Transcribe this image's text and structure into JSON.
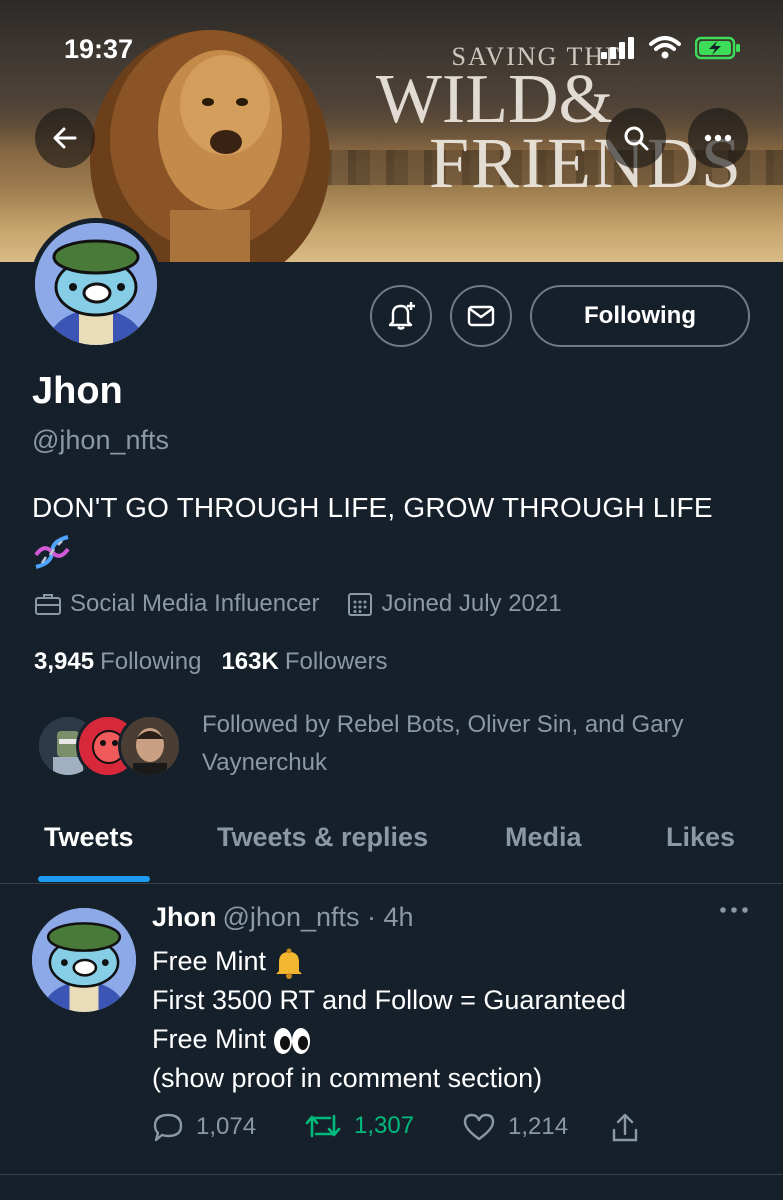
{
  "status_bar": {
    "time": "19:37"
  },
  "banner": {
    "line1": "SAVING THE",
    "line2": "WILD&",
    "line3": "FRIENDS"
  },
  "profile": {
    "name": "Jhon",
    "handle": "@jhon_nfts",
    "bio": "DON'T GO THROUGH LIFE, GROW THROUGH LIFE",
    "category": "Social Media Influencer",
    "joined": "Joined July 2021",
    "following_count": "3,945",
    "following_label": "Following",
    "followers_count": "163K",
    "followers_label": "Followers",
    "followed_by": "Followed by Rebel Bots, Oliver Sin, and Gary Vaynerchuk",
    "follow_button": "Following"
  },
  "tabs": [
    {
      "label": "Tweets",
      "active": true
    },
    {
      "label": "Tweets & replies",
      "active": false
    },
    {
      "label": "Media",
      "active": false
    },
    {
      "label": "Likes",
      "active": false
    }
  ],
  "tweet": {
    "name": "Jhon",
    "handle": "@jhon_nfts",
    "time": "· 4h",
    "lines": [
      "Free Mint",
      "First 3500 RT and Follow  = Guaranteed",
      "Free Mint",
      "(show proof in comment section)"
    ],
    "replies": "1,074",
    "retweets": "1,307",
    "likes": "1,214"
  },
  "colors": {
    "background": "#15202b",
    "accent": "#1d9bf0",
    "secondary_text": "#8b98a5",
    "retweet_green": "#00ba7c",
    "border": "#38444d"
  }
}
